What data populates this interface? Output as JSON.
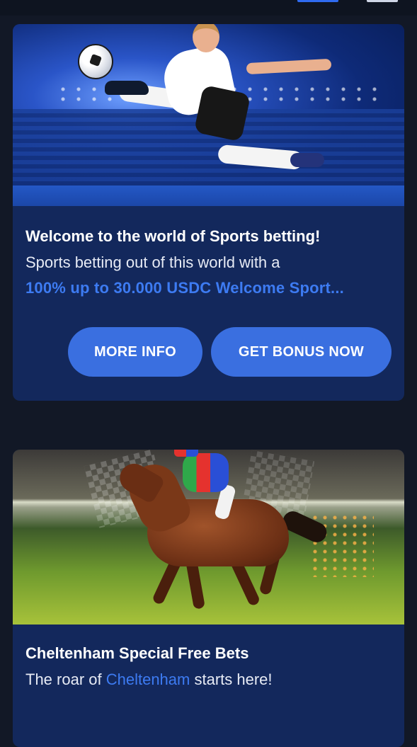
{
  "top_bar": {},
  "promos": [
    {
      "image": "soccer-player-kick-illustration",
      "title": "Welcome to the world of Sports betting!",
      "description_line1": "Sports betting out of this world with a",
      "description_line2": "100% up to 30.000 USDC Welcome Sport...",
      "buttons": {
        "more_info": "MORE INFO",
        "get_bonus": "GET BONUS NOW"
      }
    },
    {
      "image": "racehorse-jockey-illustration",
      "title": "Cheltenham Special Free Bets",
      "description_prefix": "The roar of ",
      "description_highlight": "Cheltenham",
      "description_suffix": " starts here!"
    }
  ],
  "colors": {
    "background": "#121826",
    "card": "#13285c",
    "accent": "#3d7bf2",
    "button": "#3a6fe0"
  }
}
